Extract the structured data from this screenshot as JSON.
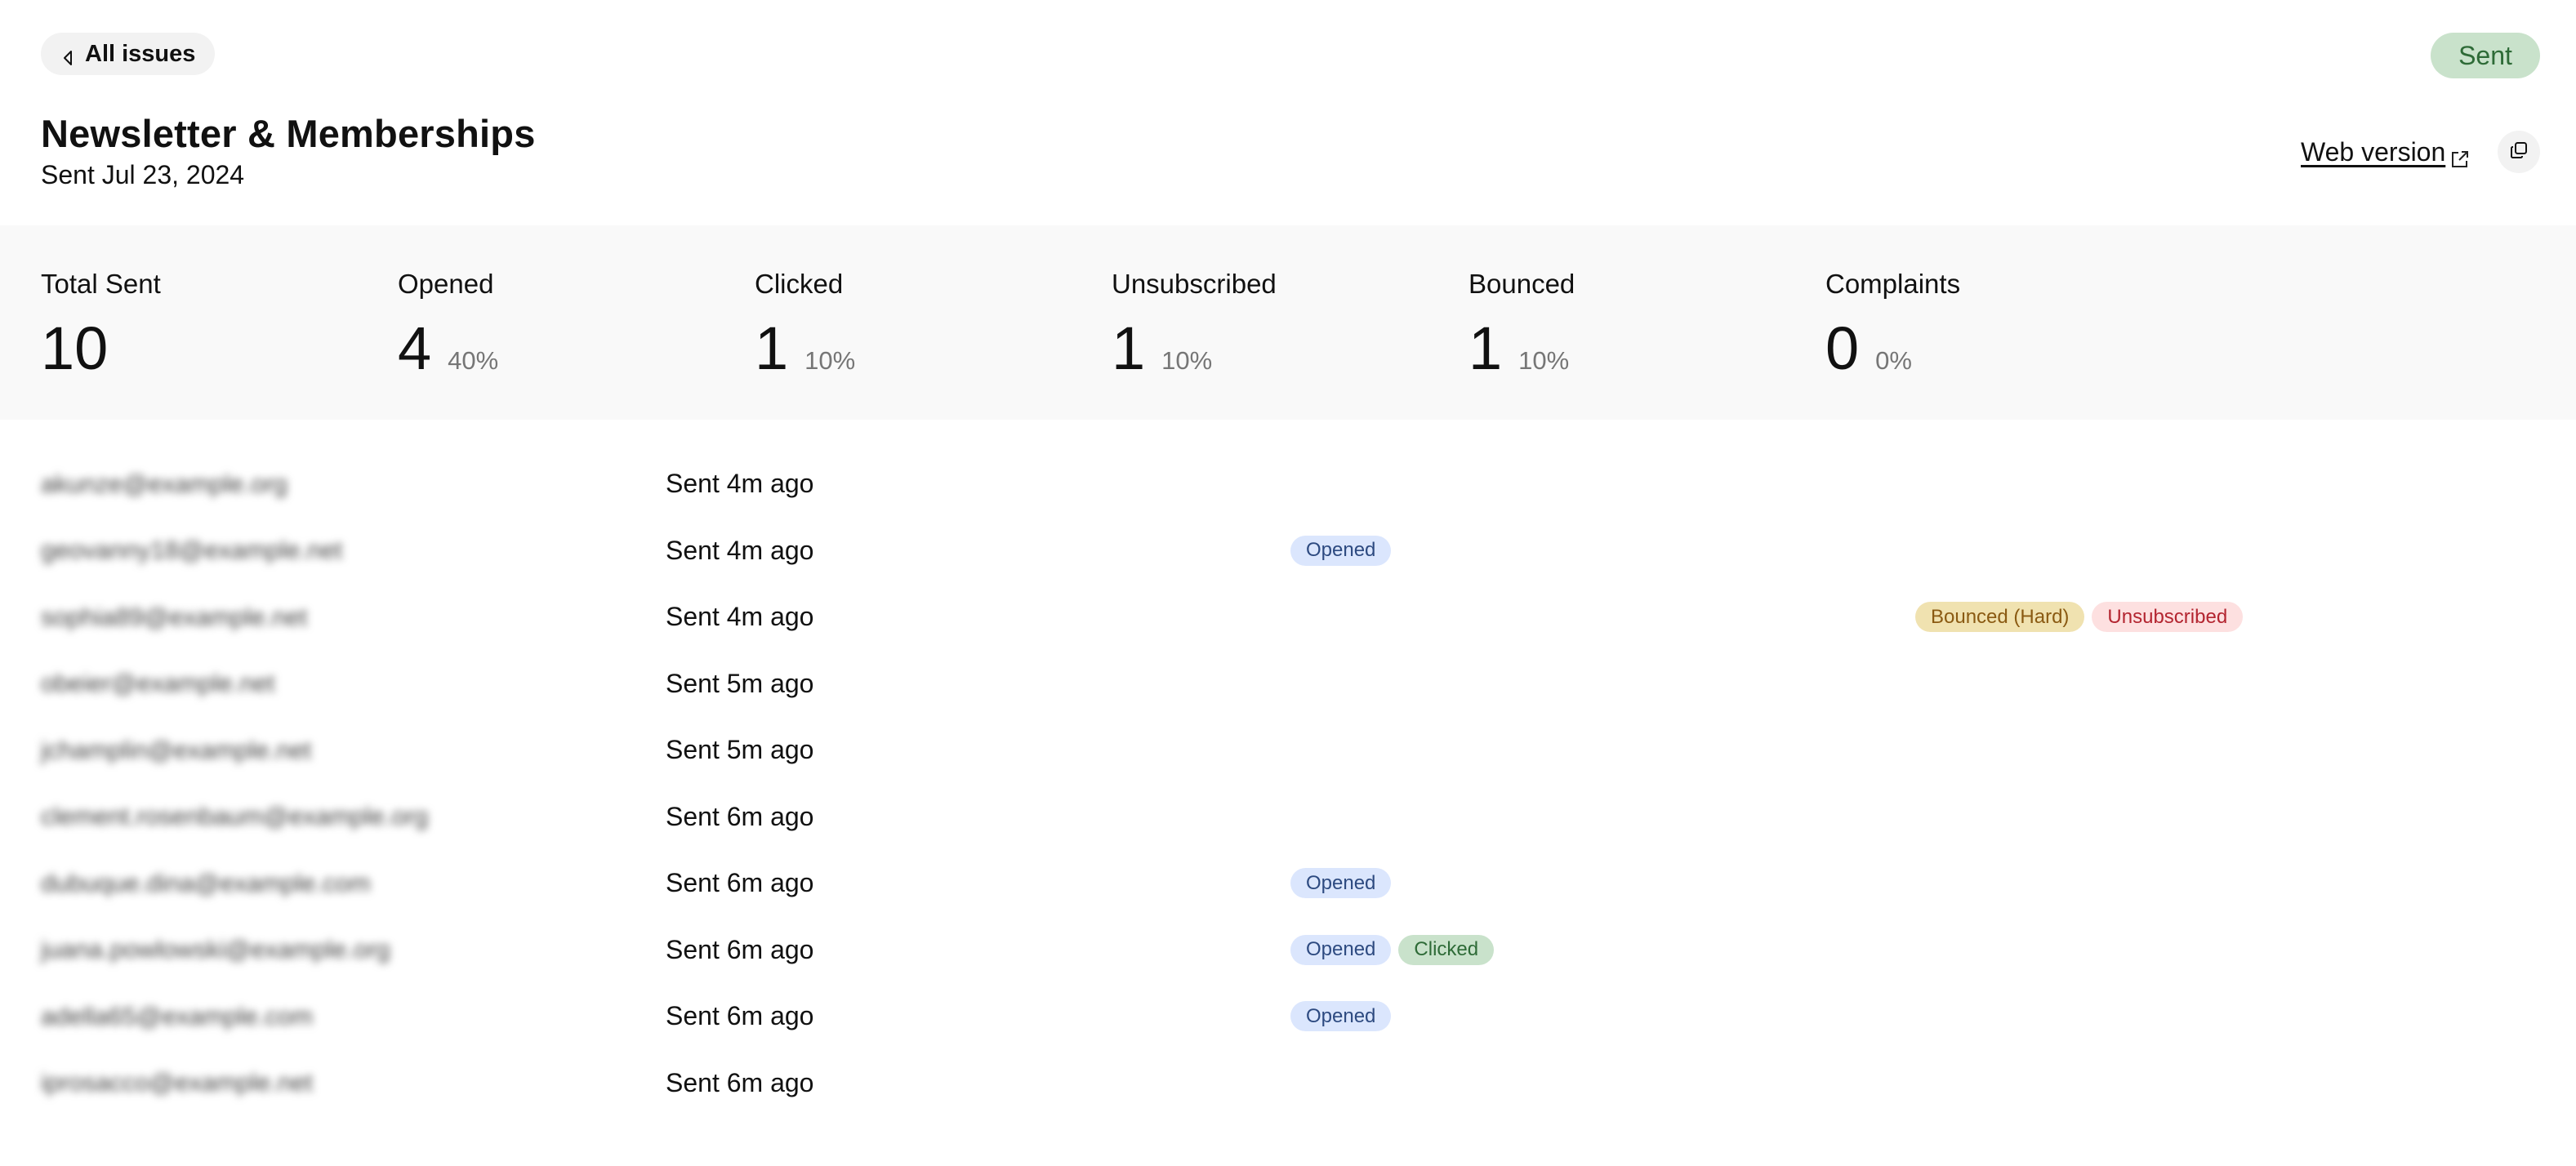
{
  "header": {
    "back_label": "All issues",
    "status": "Sent",
    "title": "Newsletter & Memberships",
    "subtitle": "Sent Jul 23, 2024",
    "web_version_label": "Web version",
    "icons": {
      "back": "chevron-left-icon",
      "external": "external-link-icon",
      "copy": "copy-icon"
    }
  },
  "stats": [
    {
      "label": "Total Sent",
      "value": "10",
      "percent": ""
    },
    {
      "label": "Opened",
      "value": "4",
      "percent": "40%"
    },
    {
      "label": "Clicked",
      "value": "1",
      "percent": "10%"
    },
    {
      "label": "Unsubscribed",
      "value": "1",
      "percent": "10%"
    },
    {
      "label": "Bounced",
      "value": "1",
      "percent": "10%"
    },
    {
      "label": "Complaints",
      "value": "0",
      "percent": "0%"
    }
  ],
  "colors": {
    "sent_badge_bg": "#c9e2cb",
    "sent_badge_text": "#2e6b37",
    "opened_bg": "#dbe6fd",
    "opened_text": "#2d4a80",
    "clicked_bg": "#c9e2cb",
    "clicked_text": "#2e6b37",
    "bounced_bg": "#f0e2b0",
    "bounced_text": "#8a5a12",
    "unsubscribed_bg": "#fde0e0",
    "unsubscribed_text": "#b32530",
    "stats_bg": "#f9f9f9",
    "muted_text": "#767676"
  },
  "recipients": [
    {
      "email": "akunze@example.org",
      "sent": "Sent 4m ago",
      "engagement": [],
      "delivery": []
    },
    {
      "email": "geovanny18@example.net",
      "sent": "Sent 4m ago",
      "engagement": [
        "Opened"
      ],
      "delivery": []
    },
    {
      "email": "sophia89@example.net",
      "sent": "Sent 4m ago",
      "engagement": [],
      "delivery": [
        "Bounced (Hard)",
        "Unsubscribed"
      ]
    },
    {
      "email": "obeier@example.net",
      "sent": "Sent 5m ago",
      "engagement": [],
      "delivery": []
    },
    {
      "email": "jchamplin@example.net",
      "sent": "Sent 5m ago",
      "engagement": [],
      "delivery": []
    },
    {
      "email": "clement.rosenbaum@example.org",
      "sent": "Sent 6m ago",
      "engagement": [],
      "delivery": []
    },
    {
      "email": "dubuque.dina@example.com",
      "sent": "Sent 6m ago",
      "engagement": [
        "Opened"
      ],
      "delivery": []
    },
    {
      "email": "juana.powlowski@example.org",
      "sent": "Sent 6m ago",
      "engagement": [
        "Opened",
        "Clicked"
      ],
      "delivery": []
    },
    {
      "email": "adella65@example.com",
      "sent": "Sent 6m ago",
      "engagement": [
        "Opened"
      ],
      "delivery": []
    },
    {
      "email": "iprosacco@example.net",
      "sent": "Sent 6m ago",
      "engagement": [],
      "delivery": []
    }
  ]
}
